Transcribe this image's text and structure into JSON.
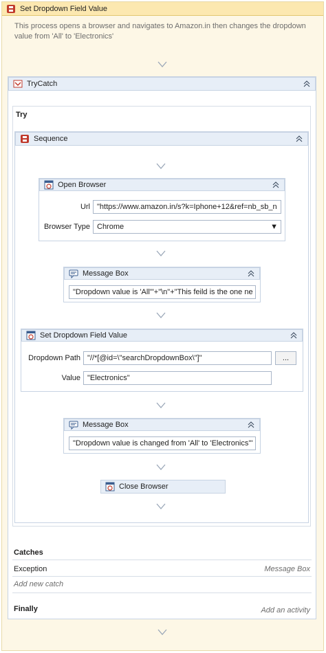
{
  "outer": {
    "title": "Set Dropdown Field Value",
    "description": "This process opens a browser and navigates to Amazon.in then changes the dropdown value from 'All' to 'Electronics'"
  },
  "trycatch": {
    "title": "TryCatch",
    "try_label": "Try",
    "catches_label": "Catches",
    "exception_label": "Exception",
    "exception_handler": "Message Box",
    "add_catch": "Add new catch",
    "finally_label": "Finally",
    "add_activity": "Add an activity"
  },
  "sequence": {
    "title": "Sequence"
  },
  "open_browser": {
    "title": "Open Browser",
    "url_label": "Url",
    "url_value": "\"https://www.amazon.in/s?k=Iphone+12&ref=nb_sb_n",
    "browser_type_label": "Browser Type",
    "browser_type_value": "Chrome"
  },
  "message_box_1": {
    "title": "Message Box",
    "text": "\"Dropdown value is 'All'\"+\"\\n\"+\"This feild is the one ne"
  },
  "set_dropdown": {
    "title": "Set Dropdown Field Value",
    "path_label": "Dropdown Path",
    "path_value": "\"//*[@id=\\\"searchDropdownBox\\\"]\"",
    "browse_button": "...",
    "value_label": "Value",
    "value_value": "\"Electronics\""
  },
  "message_box_2": {
    "title": "Message Box",
    "text": "\"Dropdown value is changed from 'All' to 'Electronics'\""
  },
  "close_browser": {
    "title": "Close Browser"
  },
  "colors": {
    "outer_bg": "#fdf7e6",
    "outer_header": "#fce8b0",
    "header_bg": "#e7eef7",
    "border": "#c7d3e3",
    "muted_text": "#6d6d6d"
  }
}
